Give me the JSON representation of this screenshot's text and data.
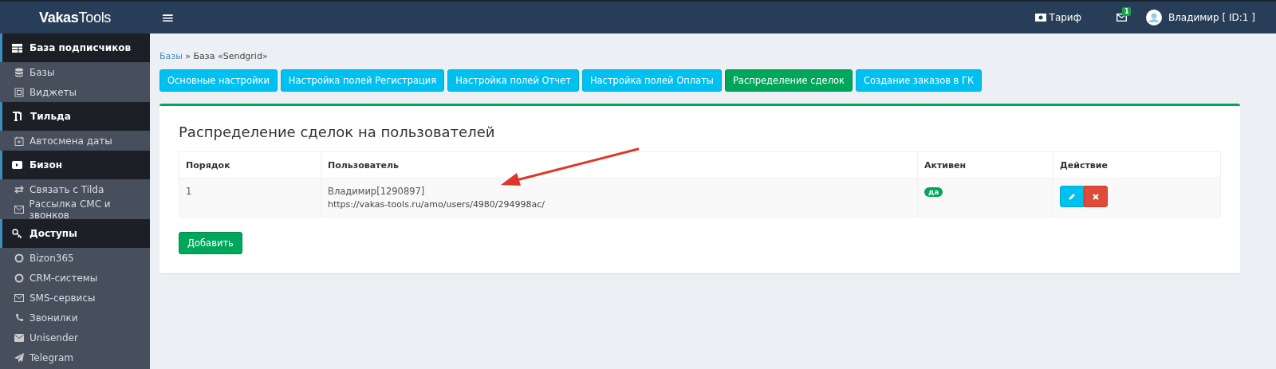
{
  "header": {
    "logo_bold": "Vakas",
    "logo_light": "Tools",
    "menu_glyph": "≡",
    "tariff": "Тариф",
    "messages_count": "1",
    "user": "Владимир [ ID:1 ]"
  },
  "sidebar": {
    "sections": [
      {
        "title": "База подписчиков",
        "items": [
          {
            "label": "Базы"
          },
          {
            "label": "Виджеты"
          }
        ]
      },
      {
        "title": "Тильда",
        "items": [
          {
            "label": "Автосмена даты"
          }
        ]
      },
      {
        "title": "Бизон",
        "items": [
          {
            "label": "Связать с Tilda"
          },
          {
            "label": "Рассылка СМС и звонков"
          }
        ]
      },
      {
        "title": "Доступы",
        "items": [
          {
            "label": "Bizon365"
          },
          {
            "label": "CRM-системы"
          },
          {
            "label": "SMS-сервисы"
          },
          {
            "label": "Звонилки"
          },
          {
            "label": "Unisender"
          },
          {
            "label": "Telegram"
          }
        ]
      }
    ]
  },
  "breadcrumb": {
    "link": "Базы",
    "separator": "»",
    "current": "База «Sendgrid»"
  },
  "tabs": [
    {
      "label": "Основные настройки",
      "selected": false
    },
    {
      "label": "Настройка полей Регистрация",
      "selected": false
    },
    {
      "label": "Настройка полей Отчет",
      "selected": false
    },
    {
      "label": "Настройка полей Оплаты",
      "selected": false
    },
    {
      "label": "Распределение сделок",
      "selected": true
    },
    {
      "label": "Создание заказов в ГК",
      "selected": false
    }
  ],
  "card": {
    "title": "Распределение сделок на пользователей",
    "table": {
      "columns": [
        "Порядок",
        "Пользователь",
        "Активен",
        "Действие"
      ],
      "rows": [
        {
          "order": "1",
          "user": "Владимир[1290897]",
          "url": "https://vakas-tools.ru/amo/users/4980/294998ac/",
          "active": "да"
        }
      ]
    },
    "add_button": "Добавить"
  }
}
